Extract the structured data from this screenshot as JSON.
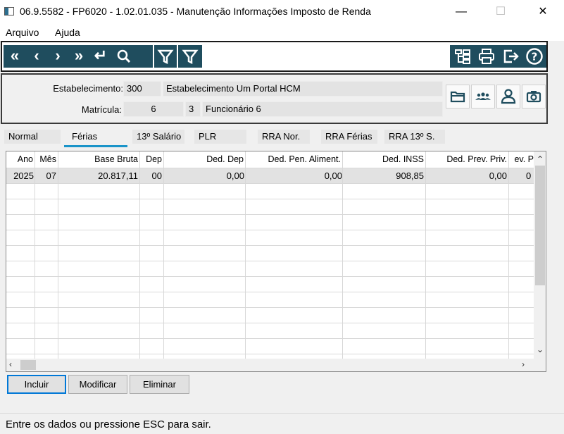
{
  "window": {
    "title": "06.9.5582 - FP6020 - 1.02.01.035 - Manutenção Informações Imposto de Renda",
    "minimize": "—",
    "maximize": "☐",
    "close": "✕"
  },
  "menu": {
    "items": [
      "Arquivo",
      "Ajuda"
    ]
  },
  "toolbar": {
    "nav_icons": [
      "first-icon",
      "previous-icon",
      "next-icon",
      "last-icon",
      "go-to-icon",
      "search-icon",
      "filter-icon",
      "filter-alt-icon"
    ],
    "nav_glyphs": [
      "«",
      "‹",
      "›",
      "»",
      "↵",
      "⚲",
      "▽",
      "▽"
    ],
    "right_icons": [
      "structure-icon",
      "print-icon",
      "exit-icon",
      "help-icon"
    ],
    "right_glyphs": [
      "⊞",
      "⎙",
      "⇥",
      "?"
    ]
  },
  "header": {
    "estabelecimento_label": "Estabelecimento:",
    "estabelecimento_code": "300",
    "estabelecimento_name": "Estabelecimento Um Portal HCM",
    "matricula_label": "Matrícula:",
    "matricula_code": "6",
    "matricula_digit": "3",
    "matricula_name": "Funcionário 6",
    "side_icons": [
      "folder-icon",
      "group-icon",
      "user-icon",
      "camera-icon"
    ]
  },
  "tabs": [
    "Normal",
    "Férias",
    "13º Salário",
    "PLR",
    "RRA Nor.",
    "RRA Férias",
    "RRA 13º S."
  ],
  "active_tab": "Férias",
  "table": {
    "columns": [
      "Ano",
      "Mês",
      "Base Bruta",
      "Dep",
      "Ded. Dep",
      "Ded. Pen. Aliment.",
      "Ded. INSS",
      "Ded. Prev. Priv.",
      "ev. P"
    ],
    "rows": [
      [
        "2025",
        "07",
        "20.817,11",
        "00",
        "0,00",
        "0,00",
        "908,85",
        "0,00",
        "0"
      ]
    ]
  },
  "buttons": {
    "incluir": "Incluir",
    "modificar": "Modificar",
    "eliminar": "Eliminar"
  },
  "status": "Entre os dados ou pressione ESC para sair.",
  "colors": {
    "toolbar_bg": "#1f4d5e",
    "tab_accent": "#1a94c9",
    "focus": "#0078d7"
  }
}
